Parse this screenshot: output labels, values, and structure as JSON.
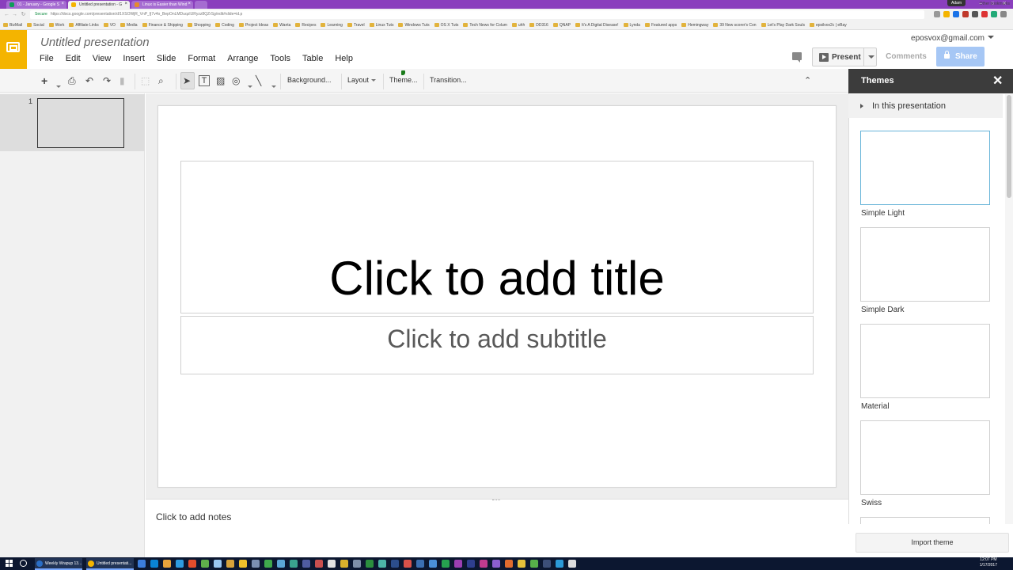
{
  "browser": {
    "tabs": [
      {
        "label": "01 - January - Google S",
        "active": false
      },
      {
        "label": "Untitled presentation - G",
        "active": true
      },
      {
        "label": "Linux is Easier than Wind",
        "active": false
      }
    ],
    "profile": "Adam",
    "window_controls": [
      "–",
      "□",
      "✕"
    ],
    "address": {
      "secure_label": "Secure",
      "url": "https://docs.google.com/presentation/d/1XSOWjR_VnP_fj7v4o_BepOnLMDuqzIURyzz8QZrSg/edit#slide=id.p"
    },
    "bookmarks": [
      "BizMail",
      "Social",
      "Work",
      "Affiliate Links",
      "VO",
      "Media",
      "Finance & Shipping",
      "Shopping",
      "Coding",
      "Project Ideas",
      "Wanta",
      "Recipes",
      "Learning",
      "Travel",
      "Linux Tuts",
      "Windows Tuts",
      "OS X Tuts",
      "Tech News for Colum",
      "uhh",
      "DD316",
      "QNAP",
      "It's A Digital Disease!",
      "Lynda",
      "Featured apps",
      "Hemingway",
      "39 New scorer's Con",
      "Let's Play Dark Souls",
      "epsilvox2c | eBay"
    ],
    "other_bookmarks": "Other bookmarks"
  },
  "app": {
    "doc_title": "Untitled presentation",
    "menu": [
      "File",
      "Edit",
      "View",
      "Insert",
      "Slide",
      "Format",
      "Arrange",
      "Tools",
      "Table",
      "Help"
    ],
    "account_email": "eposvox@gmail.com",
    "present_label": "Present",
    "comments_label": "Comments",
    "share_label": "Share"
  },
  "toolbar": {
    "background_label": "Background...",
    "layout_label": "Layout",
    "theme_label": "Theme...",
    "transition_label": "Transition..."
  },
  "filmstrip": {
    "slide_number": "1"
  },
  "slide": {
    "title_placeholder": "Click to add title",
    "subtitle_placeholder": "Click to add subtitle"
  },
  "notes": {
    "placeholder": "Click to add notes"
  },
  "themes_panel": {
    "title": "Themes",
    "section_label": "In this presentation",
    "themes": [
      "Simple Light",
      "Simple Dark",
      "Material",
      "Swiss"
    ],
    "import_label": "Import theme"
  },
  "taskbar": {
    "apps": [
      "Weekly Wrapup 13...",
      "Untitled presentati..."
    ],
    "time": "12:07 PM",
    "date": "1/17/2017"
  }
}
